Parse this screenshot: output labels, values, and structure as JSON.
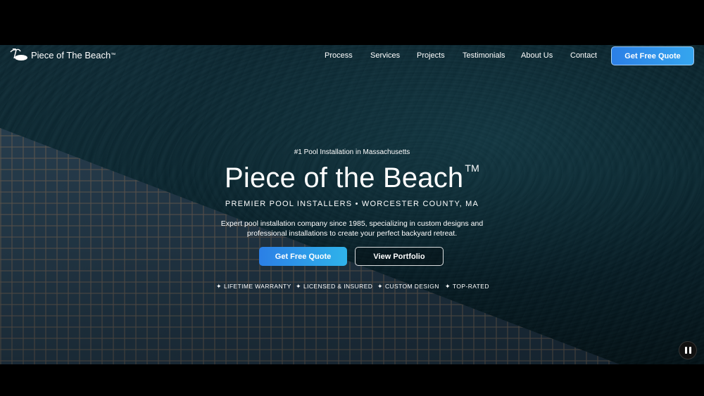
{
  "nav": {
    "brand_name": "Piece of The Beach",
    "brand_tm": "™",
    "links": [
      "Process",
      "Services",
      "Projects",
      "Testimonials",
      "About Us",
      "Contact"
    ],
    "cta_label": "Get Free Quote"
  },
  "hero": {
    "kicker": "#1 Pool Installation in Massachusetts",
    "title": "Piece of the Beach",
    "title_tm": "TM",
    "subtitle": "PREMIER POOL INSTALLERS • WORCESTER COUNTY, MA",
    "description": "Expert pool installation company since 1985, specializing in custom designs and professional installations to create your perfect backyard retreat.",
    "primary_button": "Get Free Quote",
    "secondary_button": "View Portfolio",
    "badges": [
      "LIFETIME WARRANTY",
      "LICENSED & INSURED",
      "CUSTOM DESIGN",
      "TOP-RATED"
    ],
    "badge_icon": "✦"
  },
  "icons": {
    "brand": "palm-beach-icon",
    "pause": "pause-icon"
  },
  "colors": {
    "accent_start": "#2b7fe6",
    "accent_end": "#35a6ef",
    "background": "#000000"
  }
}
